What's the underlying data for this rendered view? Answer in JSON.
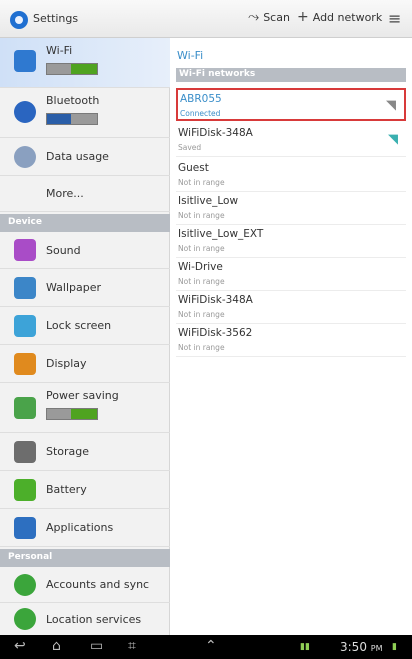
{
  "actionbar": {
    "title": "Settings",
    "scan_label": "Scan",
    "add_network_label": "Add network",
    "scan_icon": "scan-icon",
    "add_icon": "plus-icon",
    "overflow_icon": "overflow-menu-icon"
  },
  "left": {
    "wifi_label": "Wi-Fi",
    "bluetooth_label": "Bluetooth",
    "data_usage_label": "Data usage",
    "more_label": "More...",
    "device_section": "Device",
    "sound_label": "Sound",
    "wallpaper_label": "Wallpaper",
    "lock_screen_label": "Lock screen",
    "display_label": "Display",
    "power_saving_label": "Power saving",
    "storage_label": "Storage",
    "battery_label": "Battery",
    "applications_label": "Applications",
    "personal_section": "Personal",
    "accounts_label": "Accounts and sync",
    "location_label": "Location services",
    "wifi_toggle_state": "ON",
    "power_toggle_state": "ON"
  },
  "right": {
    "title": "Wi-Fi",
    "section": "Wi-Fi networks",
    "networks": [
      {
        "name": "ABR055",
        "status": "Connected"
      },
      {
        "name": "WiFiDisk-348A",
        "status": "Saved"
      },
      {
        "name": "Guest",
        "status": "Not in range"
      },
      {
        "name": "Isitlive_Low",
        "status": "Not in range"
      },
      {
        "name": "Isitlive_Low_EXT",
        "status": "Not in range"
      },
      {
        "name": "Wi-Drive",
        "status": "Not in range"
      },
      {
        "name": "WiFiDisk-348A",
        "status": "Not in range"
      },
      {
        "name": "WiFiDisk-3562",
        "status": "Not in range"
      }
    ]
  },
  "navbar": {
    "time": "3:50",
    "ampm": "PM"
  },
  "colors": {
    "accent": "#3a8ec9",
    "highlight_border": "#d83a3a",
    "toggle_on": "#4fa320"
  }
}
